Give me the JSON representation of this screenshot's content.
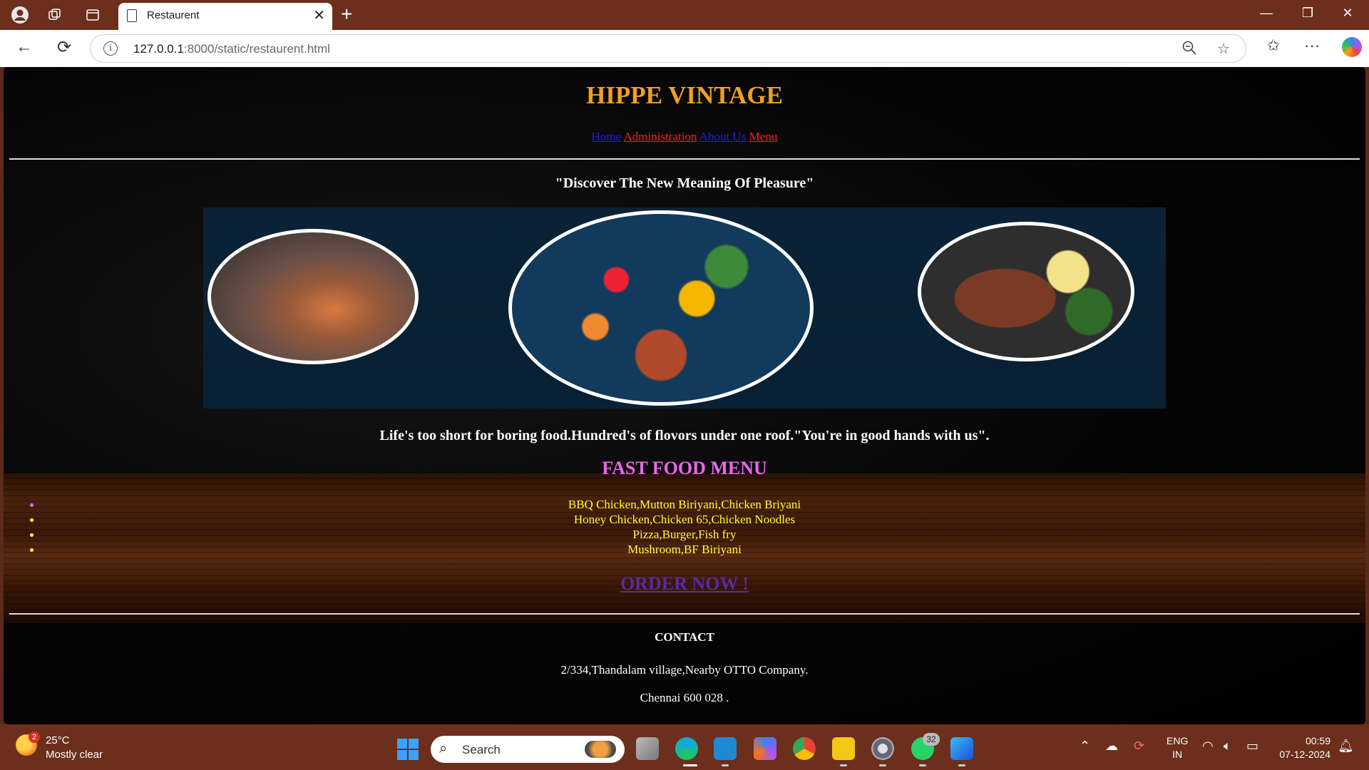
{
  "browser": {
    "tab_title": "Restaurent",
    "url_host": "127.0.0.1",
    "url_path": ":8000/static/restaurent.html"
  },
  "site": {
    "title": "HIPPE VINTAGE",
    "nav": [
      "Home",
      "Administration",
      "About Us",
      "Menu"
    ],
    "tagline": "\"Discover The New Meaning Of Pleasure\"",
    "slogan": "Life's too short for boring food.Hundred's of flovors under one roof.\"You're in good hands with us\".",
    "menu_title": "FAST FOOD MENU",
    "menu_items": [
      "BBQ Chicken,Mutton Biriyani,Chicken Briyani",
      "Honey Chicken,Chicken 65,Chicken Noodles",
      "Pizza,Burger,Fish fry",
      "Mushroom,BF Biriyani"
    ],
    "order_label": "ORDER NOW !",
    "contact_heading": "CONTACT",
    "address_line1": "2/334,Thandalam village,Nearby OTTO Company.",
    "address_line2": "Chennai 600 028 ."
  },
  "colors": {
    "title": "#f2a01a",
    "nav_blue": "#1a1aff",
    "nav_red": "#ff1a1a",
    "menu_title": "#ee66ee",
    "menu_items": "#ffff33",
    "order_link": "#5b2a9e"
  },
  "taskbar": {
    "weather_badge": "2",
    "temperature": "25°C",
    "condition": "Mostly clear",
    "search_placeholder": "Search",
    "whatsapp_badge": "32",
    "lang_line1": "ENG",
    "lang_line2": "IN",
    "time": "00:59",
    "date": "07-12-2024"
  }
}
